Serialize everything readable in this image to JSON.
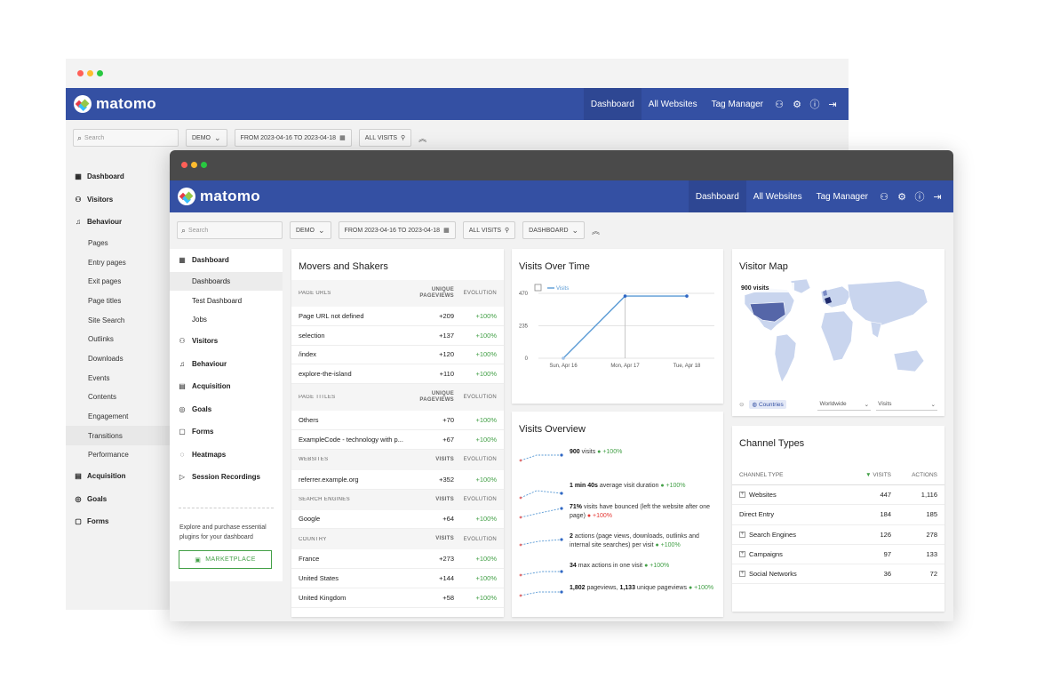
{
  "brand": "matomo",
  "nav": {
    "dashboard": "Dashboard",
    "all_websites": "All Websites",
    "tag_manager": "Tag Manager"
  },
  "toolbar": {
    "search_placeholder": "Search",
    "site": "DEMO",
    "date_range": "FROM 2023-04-16 TO 2023-04-18",
    "segment": "ALL VISITS",
    "dashboard_select": "DASHBOARD"
  },
  "back_sidebar": {
    "items": [
      {
        "label": "Dashboard",
        "icon": "dashboard-icon",
        "top": true
      },
      {
        "label": "Visitors",
        "icon": "visitors-icon",
        "top": true
      },
      {
        "label": "Behaviour",
        "icon": "bell-icon",
        "top": true
      },
      {
        "label": "Pages"
      },
      {
        "label": "Entry pages"
      },
      {
        "label": "Exit pages"
      },
      {
        "label": "Page titles"
      },
      {
        "label": "Site Search"
      },
      {
        "label": "Outlinks"
      },
      {
        "label": "Downloads"
      },
      {
        "label": "Events"
      },
      {
        "label": "Contents"
      },
      {
        "label": "Engagement"
      },
      {
        "label": "Transitions",
        "selected": true
      },
      {
        "label": "Performance"
      },
      {
        "label": "Acquisition",
        "icon": "acquisition-icon",
        "top": true
      },
      {
        "label": "Goals",
        "icon": "goals-icon",
        "top": true
      },
      {
        "label": "Forms",
        "icon": "forms-icon",
        "top": true
      }
    ]
  },
  "front_sidebar": {
    "items": [
      {
        "label": "Dashboard",
        "icon": "dashboard-icon",
        "top": true
      },
      {
        "label": "Dashboards",
        "selected": true
      },
      {
        "label": "Test Dashboard"
      },
      {
        "label": "Jobs"
      },
      {
        "label": "Visitors",
        "icon": "visitors-icon",
        "top": true
      },
      {
        "label": "Behaviour",
        "icon": "bell-icon",
        "top": true
      },
      {
        "label": "Acquisition",
        "icon": "acquisition-icon",
        "top": true
      },
      {
        "label": "Goals",
        "icon": "goals-icon",
        "top": true
      },
      {
        "label": "Forms",
        "icon": "forms-icon",
        "top": true
      },
      {
        "label": "Heatmaps",
        "icon": "heatmaps-icon",
        "top": true
      },
      {
        "label": "Session Recordings",
        "icon": "play-icon",
        "top": true
      }
    ],
    "promo": "Explore and purchase essential plugins for your dashboard",
    "marketplace": "MARKETPLACE"
  },
  "movers": {
    "title": "Movers and Shakers",
    "sections": [
      {
        "col1": "PAGE URLS",
        "col2": [
          "UNIQUE",
          "PAGEVIEWS"
        ],
        "col3": "EVOLUTION",
        "rows": [
          [
            "Page URL not defined",
            "+209",
            "+100%"
          ],
          [
            "selection",
            "+137",
            "+100%"
          ],
          [
            "/index",
            "+120",
            "+100%"
          ],
          [
            "explore-the-island",
            "+110",
            "+100%"
          ]
        ]
      },
      {
        "col1": "PAGE TITLES",
        "col2": [
          "UNIQUE",
          "PAGEVIEWS"
        ],
        "col3": "EVOLUTION",
        "rows": [
          [
            "Others",
            "+70",
            "+100%"
          ],
          [
            "ExampleCode - technology with p...",
            "+67",
            "+100%"
          ]
        ]
      },
      {
        "col1": "WEBSITES",
        "col2": [
          "VISITS"
        ],
        "col3": "EVOLUTION",
        "rows": [
          [
            "referrer.example.org",
            "+352",
            "+100%"
          ]
        ]
      },
      {
        "col1": "SEARCH ENGINES",
        "col2": [
          "VISITS"
        ],
        "col3": "EVOLUTION",
        "rows": [
          [
            "Google",
            "+64",
            "+100%"
          ]
        ]
      },
      {
        "col1": "COUNTRY",
        "col2": [
          "VISITS"
        ],
        "col3": "EVOLUTION",
        "rows": [
          [
            "France",
            "+273",
            "+100%"
          ],
          [
            "United States",
            "+144",
            "+100%"
          ],
          [
            "United Kingdom",
            "+58",
            "+100%"
          ]
        ]
      }
    ]
  },
  "visits_over_time": {
    "title": "Visits Over Time",
    "legend": "Visits"
  },
  "chart_data": {
    "type": "line",
    "title": "Visits Over Time",
    "categories": [
      "Sun, Apr 16",
      "Mon, Apr 17",
      "Tue, Apr 18"
    ],
    "series": [
      {
        "name": "Visits",
        "values": [
          0,
          450,
          450
        ]
      }
    ],
    "y_ticks": [
      "470",
      "235",
      "0"
    ],
    "ylim": [
      0,
      470
    ],
    "grid": true,
    "legend": "top-left"
  },
  "visits_overview": {
    "title": "Visits Overview",
    "items": [
      {
        "bold": "900",
        "text": " visits",
        "evo": "+100%"
      },
      {
        "bold": "1 min 40s",
        "text": " average visit duration",
        "evo": "+100%"
      },
      {
        "bold": "71%",
        "text": " visits have bounced (left the website after one page)",
        "evo": "+100%",
        "evo_color": "#e53935"
      },
      {
        "bold": "2",
        "text": " actions (page views, downloads, outlinks and internal site searches) per visit",
        "evo": "+100%"
      },
      {
        "bold": "34",
        "text": " max actions in one visit",
        "evo": "+100%"
      },
      {
        "bold": "1,802",
        "text": " pageviews, ",
        "bold2": "1,133",
        "text2": " unique pageviews",
        "evo": "+100%"
      }
    ]
  },
  "visitor_map": {
    "title": "Visitor Map",
    "tooltip": "900 visits",
    "link": "Countries",
    "select1": "Worldwide",
    "select2": "Visits"
  },
  "channel_types": {
    "title": "Channel Types",
    "headers": [
      "CHANNEL TYPE",
      "VISITS",
      "ACTIONS"
    ],
    "rows": [
      {
        "label": "Websites",
        "visits": "447",
        "actions": "1,116",
        "expandable": true
      },
      {
        "label": "Direct Entry",
        "visits": "184",
        "actions": "185",
        "expandable": false
      },
      {
        "label": "Search Engines",
        "visits": "126",
        "actions": "278",
        "expandable": true
      },
      {
        "label": "Campaigns",
        "visits": "97",
        "actions": "133",
        "expandable": true
      },
      {
        "label": "Social Networks",
        "visits": "36",
        "actions": "72",
        "expandable": true
      }
    ]
  },
  "colors": {
    "navbar": "#3450a3",
    "positive": "#43a047",
    "negative": "#e53935",
    "series": "#5b9bd5"
  }
}
